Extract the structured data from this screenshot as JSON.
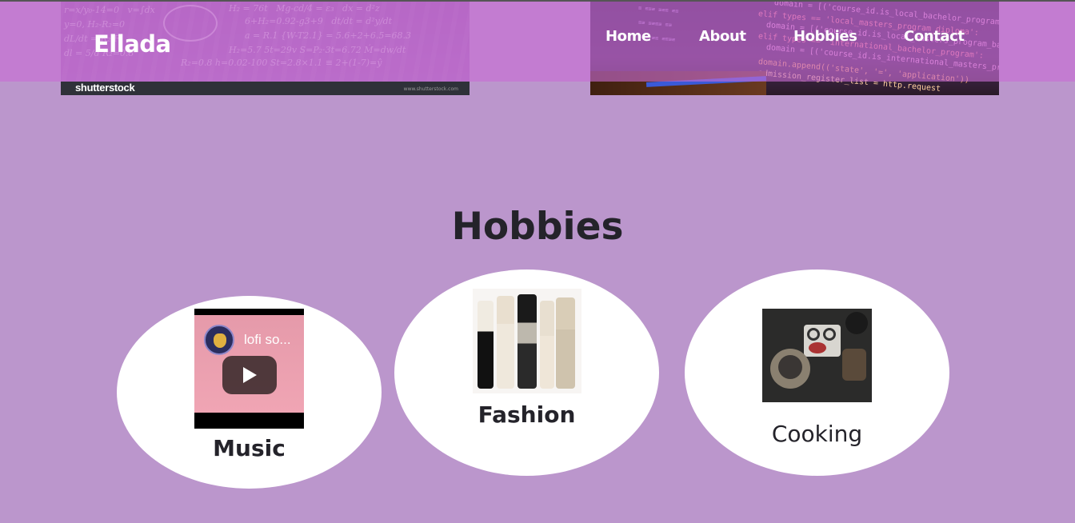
{
  "header": {
    "brand": "Ellada",
    "nav": [
      {
        "label": "Home"
      },
      {
        "label": "About"
      },
      {
        "label": "Hobbies"
      },
      {
        "label": "Contact"
      }
    ]
  },
  "banner": {
    "stock_watermark": "shutterstock"
  },
  "section": {
    "title": "Hobbies"
  },
  "hobbies": [
    {
      "label": "Music",
      "video_title": "lofi so..."
    },
    {
      "label": "Fashion"
    },
    {
      "label": "Cooking"
    }
  ],
  "colors": {
    "page_background": "#bb96cc",
    "navbar": "#c86cd4",
    "card": "#ffffff",
    "text": "#24232a"
  }
}
